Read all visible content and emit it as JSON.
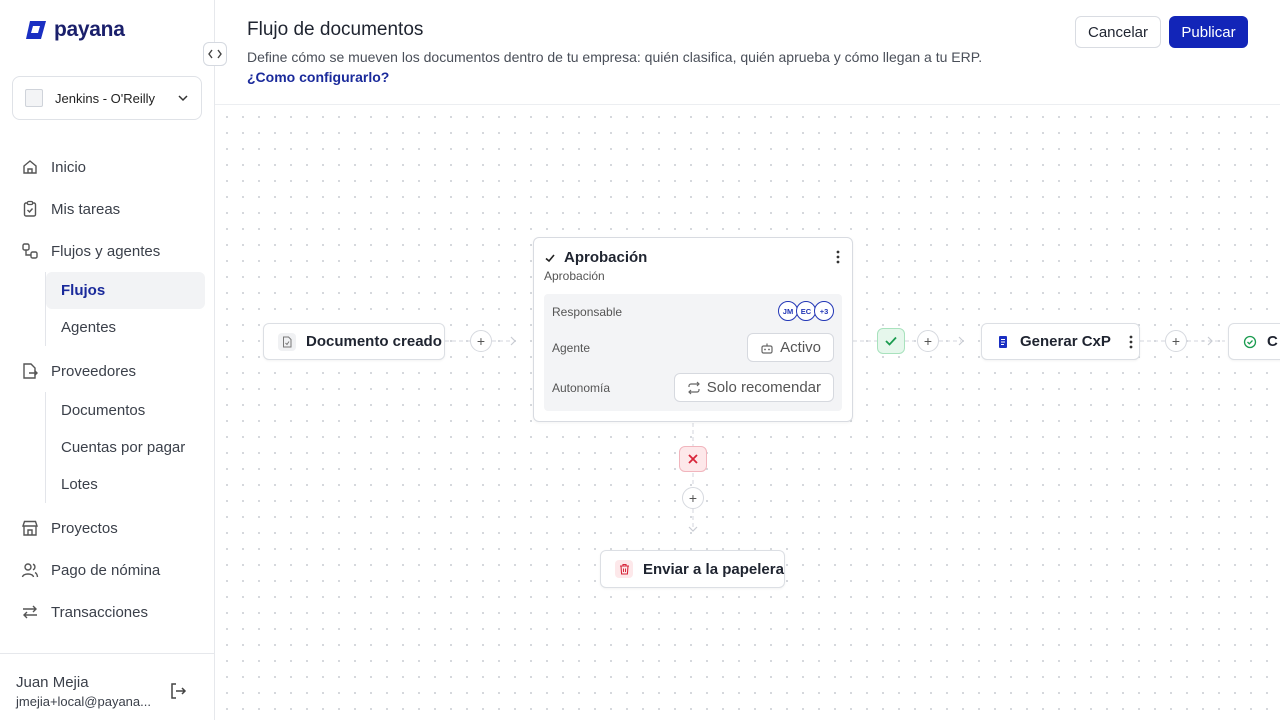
{
  "brand": {
    "name": "payana"
  },
  "company": {
    "name": "Jenkins - O'Reilly"
  },
  "nav": {
    "inicio": "Inicio",
    "tareas": "Mis tareas",
    "flujos": "Flujos y agentes",
    "flujos_sub": [
      "Flujos",
      "Agentes"
    ],
    "proveedores": "Proveedores",
    "proveedores_sub": [
      "Documentos",
      "Cuentas por pagar",
      "Lotes"
    ],
    "proyectos": "Proyectos",
    "nomina": "Pago de nómina",
    "transacciones": "Transacciones"
  },
  "user": {
    "name": "Juan Mejia",
    "email": "jmejia+local@payana..."
  },
  "header": {
    "title": "Flujo de documentos",
    "subtitle": "Define cómo se mueven los documentos dentro de tu empresa: quién clasifica, quién aprueba y cómo llegan a tu ERP.",
    "help_link": "¿Como configurarlo?",
    "cancel": "Cancelar",
    "publish": "Publicar"
  },
  "flow": {
    "start_node": "Documento creado",
    "approval": {
      "title": "Aprobación",
      "subtitle": "Aprobación",
      "responsable_label": "Responsable",
      "avatars": [
        "JM",
        "EC",
        "+3"
      ],
      "agent_label": "Agente",
      "agent_value": "Activo",
      "autonomy_label": "Autonomía",
      "autonomy_value": "Solo recomendar"
    },
    "generate_node": "Generar CxP",
    "next_node_partial": "C",
    "reject_node": "Enviar a la papelera",
    "plus_symbol": "+"
  },
  "colors": {
    "accent": "#1225b8",
    "success": "#1a9b4f",
    "danger": "#d8263b"
  }
}
